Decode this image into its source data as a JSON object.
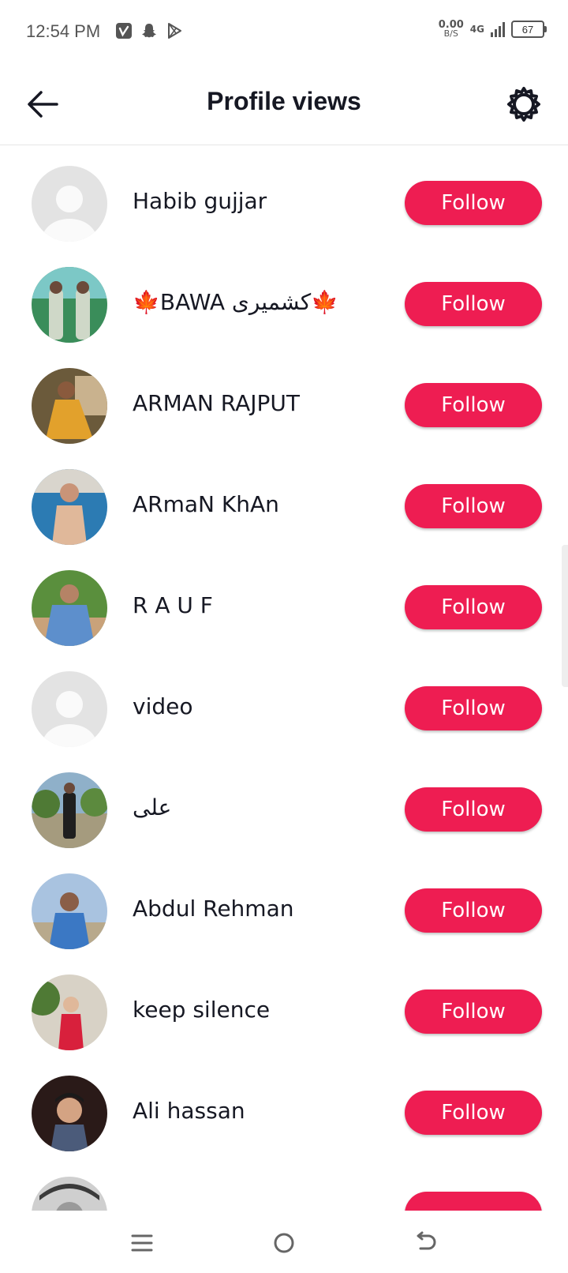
{
  "status_bar": {
    "time": "12:54 PM",
    "speed_value": "0.00",
    "speed_unit": "B/S",
    "network": "4G",
    "battery": "67",
    "app_icons": [
      "vimeo-icon",
      "snapchat-icon",
      "play-store-icon"
    ]
  },
  "header": {
    "title": "Profile views",
    "back_icon": "back-arrow-icon",
    "settings_icon": "gear-icon"
  },
  "follow_button_color": "#ee1d52",
  "viewers": [
    {
      "name": "Habib gujjar",
      "button": "Follow"
    },
    {
      "name": "🍁BAWA کشمیری🍁",
      "button": "Follow"
    },
    {
      "name": "ARMAN RAJPUT",
      "button": "Follow"
    },
    {
      "name": "ARmaN KhAn",
      "button": "Follow"
    },
    {
      "name": "R A U F",
      "button": "Follow"
    },
    {
      "name": "video",
      "button": "Follow"
    },
    {
      "name": "علی",
      "button": "Follow"
    },
    {
      "name": "Abdul Rehman",
      "button": "Follow"
    },
    {
      "name": "keep silence",
      "button": "Follow"
    },
    {
      "name": "Ali hassan",
      "button": "Follow"
    }
  ],
  "nav_bar": {
    "icons": [
      "menu-icon",
      "home-circle-icon",
      "back-icon"
    ]
  }
}
